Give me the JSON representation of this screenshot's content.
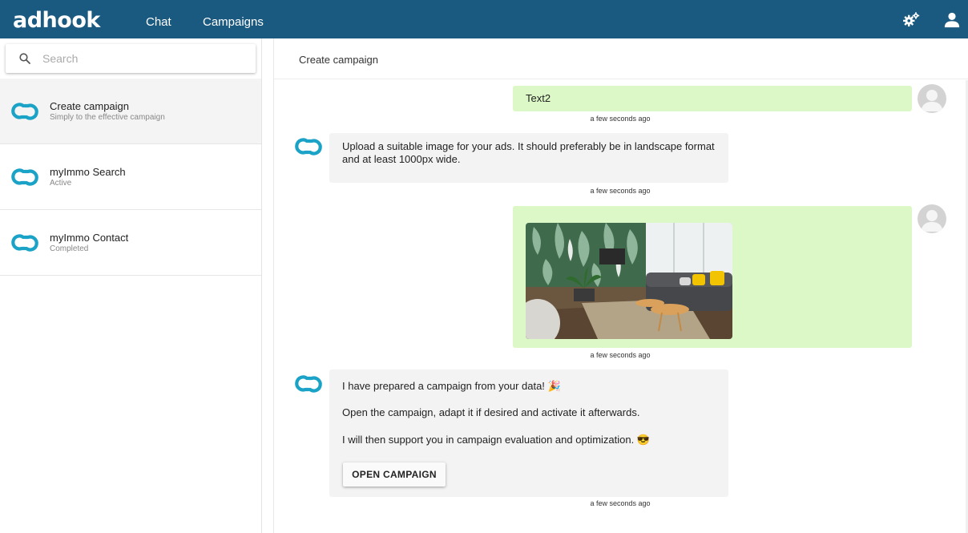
{
  "app": {
    "logo": "adhook"
  },
  "nav": {
    "chat": "Chat",
    "campaigns": "Campaigns"
  },
  "icons": {
    "settings": "gears-icon",
    "user": "user-icon",
    "search": "search-icon",
    "brand": "link-icon"
  },
  "colors": {
    "topbar": "#1b5a80",
    "brand": "#1aa3c7",
    "user_bubble": "#dcf8c6",
    "bot_bubble": "#f3f3f3"
  },
  "search": {
    "placeholder": "Search",
    "value": ""
  },
  "sidebar": {
    "items": [
      {
        "title": "Create campaign",
        "subtitle": "Simply to the effective campaign",
        "active": true
      },
      {
        "title": "myImmo Search",
        "subtitle": "Active",
        "active": false
      },
      {
        "title": "myImmo Contact",
        "subtitle": "Completed",
        "active": false
      }
    ]
  },
  "main": {
    "header_title": "Create campaign",
    "messages": [
      {
        "from": "user",
        "text": "Text2",
        "time": "a few seconds ago"
      },
      {
        "from": "bot",
        "text": "Upload a suitable image for your ads. It should preferably be in landscape format and at least 1000px wide.",
        "time": "a few seconds ago"
      },
      {
        "from": "user",
        "type": "image",
        "time": "a few seconds ago"
      },
      {
        "from": "bot",
        "lines": [
          "I have prepared a campaign from your data! 🎉",
          "Open the campaign, adapt it if desired and activate it afterwards.",
          "I will then support you in campaign evaluation and optimization. 😎"
        ],
        "button": "OPEN CAMPAIGN",
        "time": "a few seconds ago"
      }
    ]
  }
}
